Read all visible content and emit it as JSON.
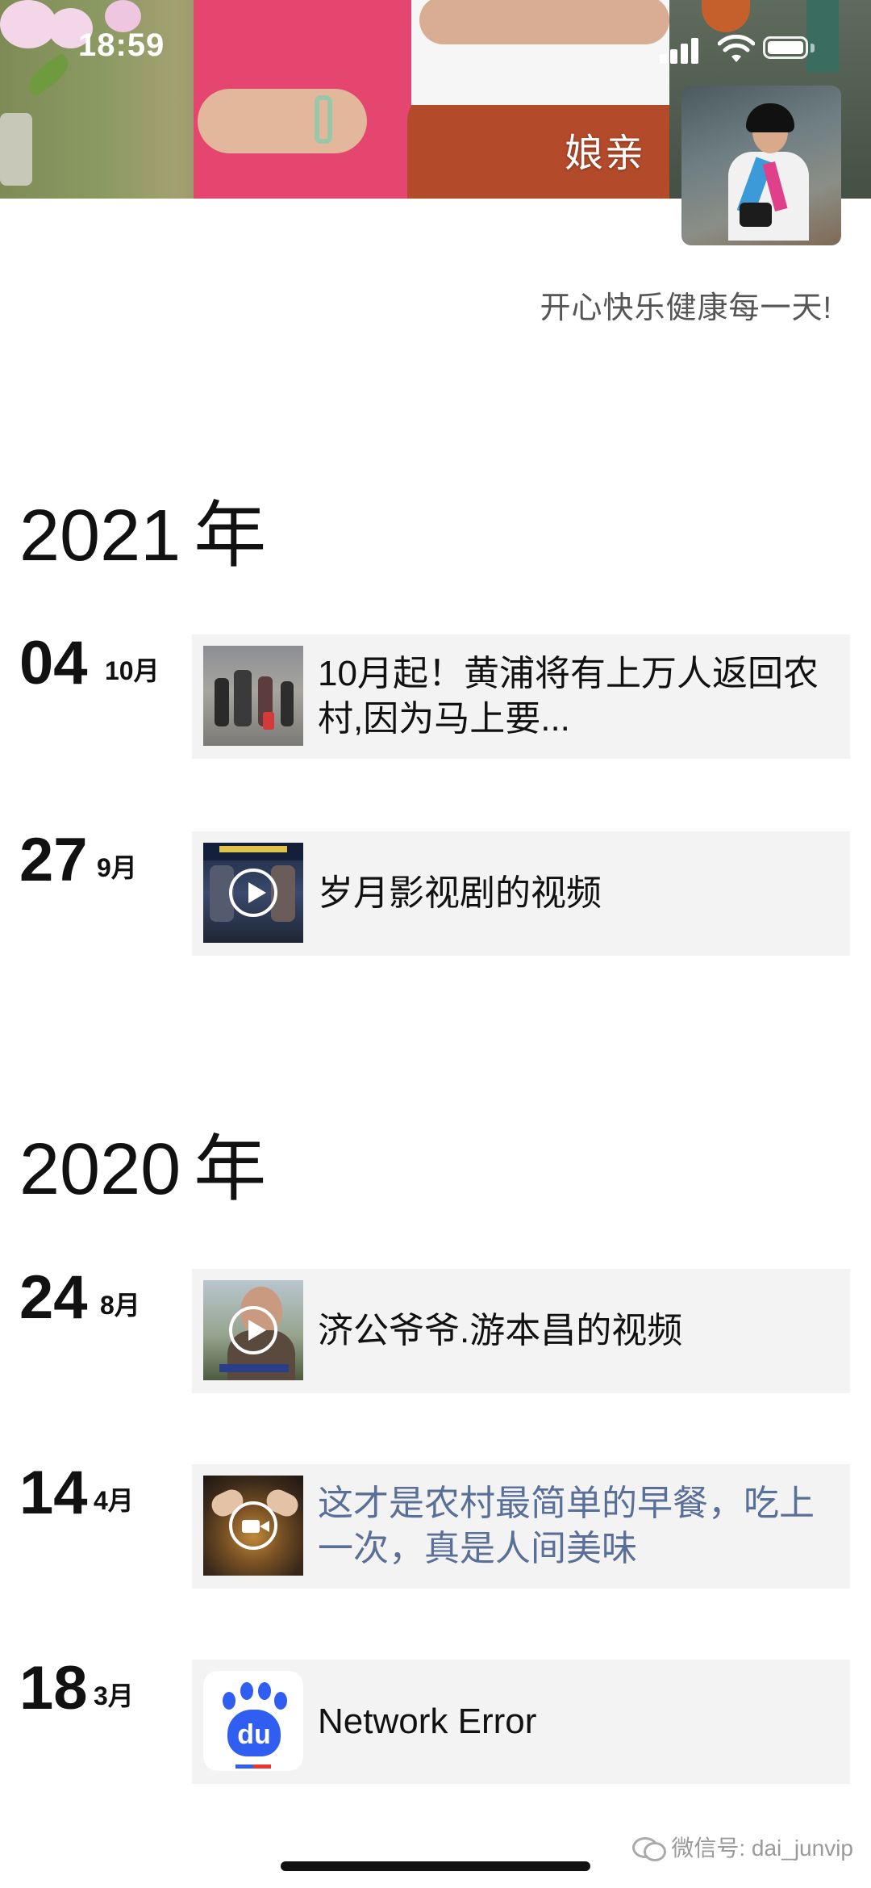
{
  "status_bar": {
    "time": "18:59"
  },
  "profile": {
    "nickname": "娘亲",
    "signature": "开心快乐健康每一天!"
  },
  "timeline": [
    {
      "year": "2021",
      "year_unit": "年",
      "entries": [
        {
          "day": "04",
          "month": "10月",
          "title": "10月起！黄浦将有上万人返回农村,因为马上要...",
          "title_style": "normal",
          "thumb_icon": "photo"
        },
        {
          "day": "27",
          "month": "9月",
          "title": "岁月影视剧的视频",
          "title_style": "normal",
          "thumb_icon": "play-icon"
        }
      ]
    },
    {
      "year": "2020",
      "year_unit": "年",
      "entries": [
        {
          "day": "24",
          "month": "8月",
          "title": "济公爷爷.游本昌的视频",
          "title_style": "normal",
          "thumb_icon": "play-icon"
        },
        {
          "day": "14",
          "month": "4月",
          "title": "这才是农村最简单的早餐，吃上一次，真是人间美味",
          "title_style": "link",
          "thumb_icon": "video-camera-icon"
        },
        {
          "day": "18",
          "month": "3月",
          "title": "Network Error",
          "title_style": "normal",
          "thumb_icon": "baidu-logo",
          "thumb_text": "du"
        }
      ]
    }
  ],
  "watermark": {
    "text": "微信号: dai_junvip",
    "icon": "wechat-icon"
  },
  "colors": {
    "link": "#5a6f98",
    "card_bg": "#f3f3f3",
    "baidu_blue": "#2f5ef0"
  }
}
